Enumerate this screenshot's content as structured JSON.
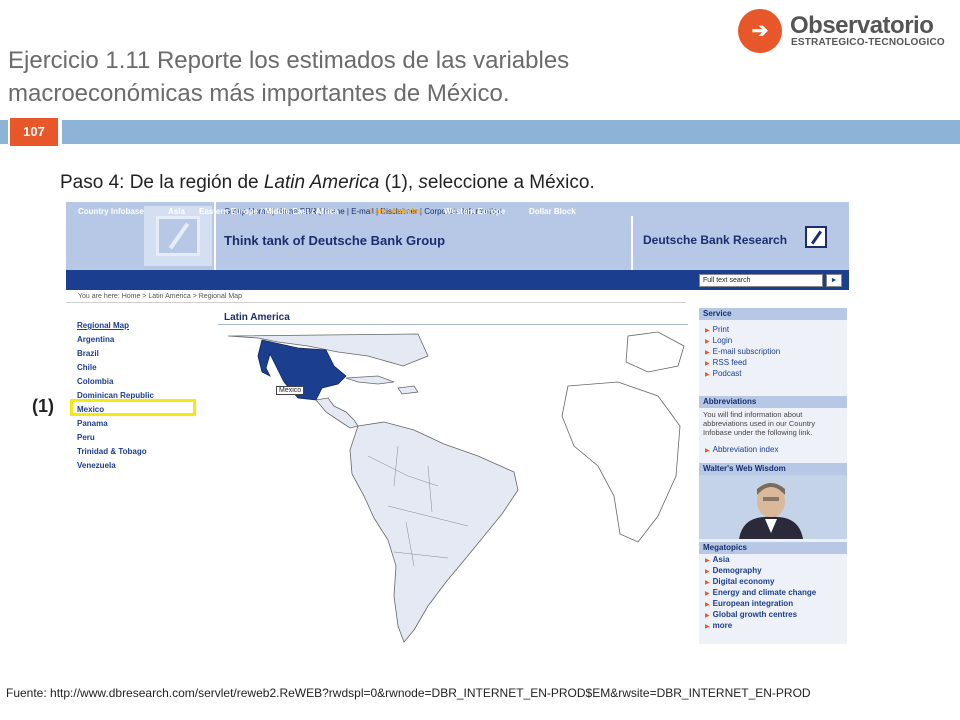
{
  "slide": {
    "title": "Ejercicio 1.11 Reporte los estimados de las variables macroeconómicas más importantes de México.",
    "page_number": "107",
    "step_prefix": "Paso 4: De la región de ",
    "step_italic": "Latin America",
    "step_mid": " (1), ",
    "step_italic2": "s",
    "step_suffix": "eleccione a México.",
    "marker": "(1)",
    "footer": "Fuente: http://www.dbresearch.com/servlet/reweb2.ReWEB?rwdspl=0&rwnode=DBR_INTERNET_EN-PROD$EM&rwsite=DBR_INTERNET_EN-PROD"
  },
  "logo": {
    "name": "Observatorio",
    "subtitle": "ESTRATEGICO-TECNOLOGICO",
    "accent": "#e8572a"
  },
  "website": {
    "top_links": "Group Home | Home DBR | Home | E-mail | Disclaimer | Corporate Information",
    "tagline": "Think tank of Deutsche Bank Group",
    "brand": "Deutsche Bank Research",
    "nav": [
      "Country Infobase",
      "Asia",
      "Eastern Europe / Middle East / Africa",
      "Latin America",
      "Western Europe",
      "Dollar Block"
    ],
    "nav_active": "Latin America",
    "search_placeholder": "Full text search",
    "search_button": "►",
    "breadcrumb": "You are here:  Home > Latin America > Regional Map",
    "countries": [
      "Regional Map",
      "Argentina",
      "Brazil",
      "Chile",
      "Colombia",
      "Dominican Republic",
      "Mexico",
      "Panama",
      "Peru",
      "Trinidad & Tobago",
      "Venezuela"
    ],
    "map_title": "Latin America",
    "map_tooltip": "Mexico",
    "service": {
      "title": "Service",
      "items": [
        "Print",
        "Login",
        "E-mail subscription",
        "RSS feed",
        "Podcast"
      ]
    },
    "abbreviations": {
      "title": "Abbreviations",
      "text": "You will find information about abbreviations used in our Country Infobase under the following link.",
      "link": "Abbreviation index"
    },
    "wisdom": {
      "title": "Walter's Web Wisdom"
    },
    "megatopics": {
      "title": "Megatopics",
      "items": [
        "Asia",
        "Demography",
        "Digital economy",
        "Energy and climate change",
        "European integration",
        "Global growth centres",
        "more"
      ]
    },
    "colors": {
      "nav": "#1c3e8e",
      "header": "#b6c8e6",
      "highlight": "#f2ea12",
      "bar": "#8db3d6"
    }
  }
}
